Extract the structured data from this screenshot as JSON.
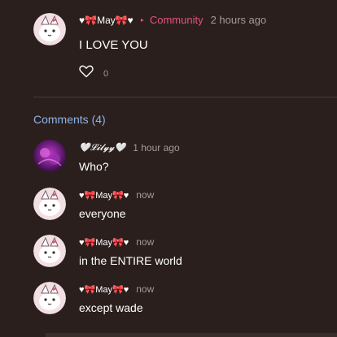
{
  "post": {
    "username": "♥🎀May🎀♥",
    "separator": "▸",
    "community": "Community",
    "time": "2 hours ago",
    "text": "I LOVE YOU",
    "like_count": "0"
  },
  "comments_heading": "Comments (4)",
  "comments": [
    {
      "username": "🤍𝓛𝓲𝓵𝔂𝔂🤍",
      "time": "1 hour ago",
      "text": "Who?"
    },
    {
      "username": "♥🎀May🎀♥",
      "time": "now",
      "text": "everyone"
    },
    {
      "username": "♥🎀May🎀♥",
      "time": "now",
      "text": "in the ENTIRE world"
    },
    {
      "username": "♥🎀May🎀♥",
      "time": "now",
      "text": "except wade"
    }
  ],
  "colors": {
    "background": "#2a1f1d",
    "accent": "#e4547a",
    "link_blue": "#8fb3e6",
    "muted": "#a69895"
  }
}
